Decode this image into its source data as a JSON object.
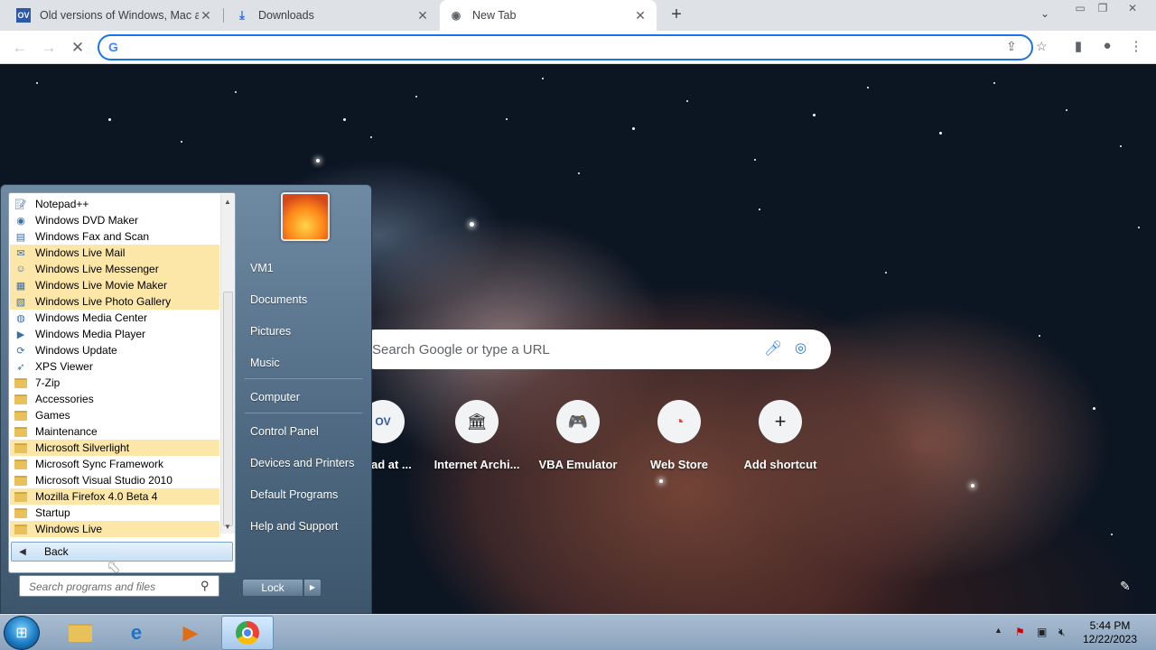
{
  "browser": {
    "tabs": [
      {
        "favicon": "OV",
        "title": "Old versions of Windows, Mac and...",
        "close": "✕"
      },
      {
        "favicon": "download-icon",
        "title": "Downloads",
        "close": "✕"
      },
      {
        "favicon": "chrome-icon",
        "title": "New Tab",
        "close": "✕"
      }
    ],
    "new_tab": "+",
    "omnibox": {
      "value": "",
      "placeholder": ""
    }
  },
  "ntp": {
    "search_placeholder": "Search Google or type a URL",
    "shortcuts": [
      {
        "label": "...oad at ...",
        "icon": "OV"
      },
      {
        "label": "Internet Archi...",
        "icon": "🏛"
      },
      {
        "label": "VBA Emulator",
        "icon": "🎮"
      },
      {
        "label": "Web Store",
        "icon": "◔"
      },
      {
        "label": "Add shortcut",
        "icon": "+"
      }
    ]
  },
  "start_menu": {
    "programs": [
      {
        "label": "Notepad++",
        "icon": "notepad-icon",
        "highlight": false
      },
      {
        "label": "Windows DVD Maker",
        "icon": "dvd-icon",
        "highlight": false
      },
      {
        "label": "Windows Fax and Scan",
        "icon": "fax-icon",
        "highlight": false
      },
      {
        "label": "Windows Live Mail",
        "icon": "mail-icon",
        "highlight": true
      },
      {
        "label": "Windows Live Messenger",
        "icon": "messenger-icon",
        "highlight": true
      },
      {
        "label": "Windows Live Movie Maker",
        "icon": "movie-icon",
        "highlight": true
      },
      {
        "label": "Windows Live Photo Gallery",
        "icon": "photo-icon",
        "highlight": true
      },
      {
        "label": "Windows Media Center",
        "icon": "media-center-icon",
        "highlight": false
      },
      {
        "label": "Windows Media Player",
        "icon": "media-player-icon",
        "highlight": false
      },
      {
        "label": "Windows Update",
        "icon": "update-icon",
        "highlight": false
      },
      {
        "label": "XPS Viewer",
        "icon": "xps-icon",
        "highlight": false
      },
      {
        "label": "7-Zip",
        "icon": "folder-icon",
        "highlight": false
      },
      {
        "label": "Accessories",
        "icon": "folder-icon",
        "highlight": false
      },
      {
        "label": "Games",
        "icon": "folder-icon",
        "highlight": false
      },
      {
        "label": "Maintenance",
        "icon": "folder-icon",
        "highlight": false
      },
      {
        "label": "Microsoft Silverlight",
        "icon": "folder-icon",
        "highlight": true
      },
      {
        "label": "Microsoft Sync Framework",
        "icon": "folder-icon",
        "highlight": false
      },
      {
        "label": "Microsoft Visual Studio 2010",
        "icon": "folder-icon",
        "highlight": false
      },
      {
        "label": "Mozilla Firefox 4.0 Beta 4",
        "icon": "folder-icon",
        "highlight": true
      },
      {
        "label": "Startup",
        "icon": "folder-icon",
        "highlight": false
      },
      {
        "label": "Windows Live",
        "icon": "folder-icon",
        "highlight": true
      }
    ],
    "back_label": "Back",
    "search_placeholder": "Search programs and files",
    "right_links": [
      "VM1",
      "Documents",
      "Pictures",
      "Music",
      "Computer",
      "Control Panel",
      "Devices and Printers",
      "Default Programs",
      "Help and Support"
    ],
    "lock_label": "Lock"
  },
  "taskbar": {
    "time": "5:44 PM",
    "date": "12/22/2023"
  },
  "colors": {
    "accent": "#1a73e8",
    "highlight": "#fce7a8"
  }
}
